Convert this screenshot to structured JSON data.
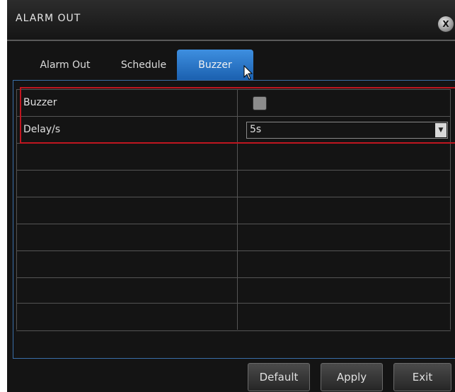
{
  "window": {
    "title": "ALARM OUT",
    "close_label": "X"
  },
  "tabs": [
    {
      "label": "Alarm Out"
    },
    {
      "label": "Schedule"
    },
    {
      "label": "Buzzer"
    }
  ],
  "settings": {
    "buzzer": {
      "label": "Buzzer",
      "checked": false
    },
    "delay": {
      "label": "Delay/s",
      "value": "5s"
    }
  },
  "buttons": {
    "default_label": "Default",
    "apply_label": "Apply",
    "exit_label": "Exit"
  },
  "colors": {
    "active_tab": "#2a7fd4",
    "highlight": "#c01620",
    "background": "#141414"
  }
}
